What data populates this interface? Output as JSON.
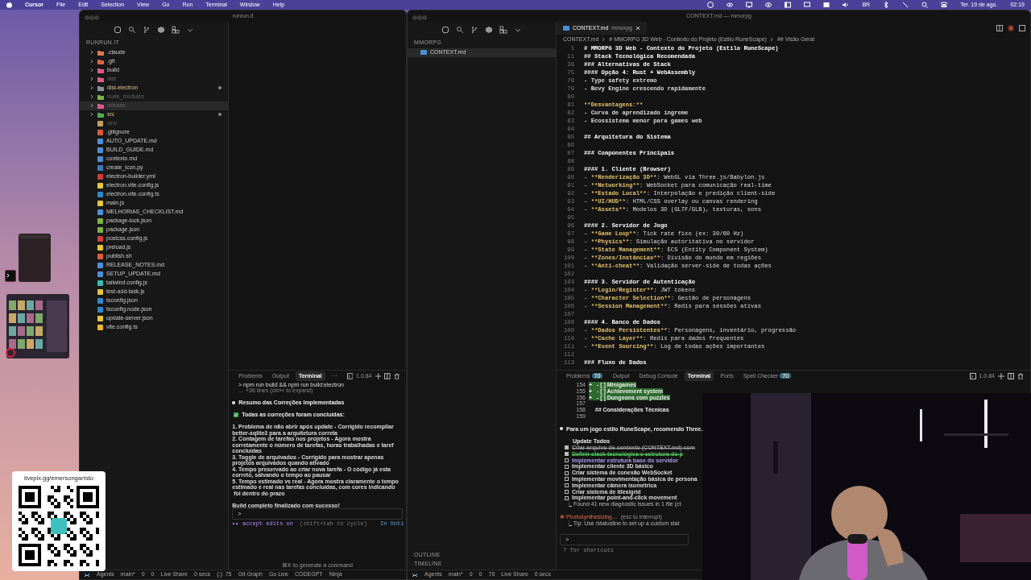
{
  "menubar": {
    "app": "Cursor",
    "menus": [
      "File",
      "Edit",
      "Selection",
      "View",
      "Go",
      "Run",
      "Terminal",
      "Window",
      "Help"
    ],
    "input_source": "BR",
    "date": "Ter. 19 de ago.",
    "time": "02:19"
  },
  "left_window": {
    "title": "runrun.it",
    "explorer_title": "RUNRUN.IT",
    "tree": [
      {
        "name": ".claude",
        "kind": "folder",
        "color": "#e8744f",
        "dimmed": false,
        "modified": false,
        "selected": false
      },
      {
        "name": ".git",
        "kind": "folder",
        "color": "#e0603f",
        "dimmed": false,
        "modified": false,
        "selected": false
      },
      {
        "name": "build",
        "kind": "folder",
        "color": "#e25a8c",
        "dimmed": false,
        "modified": false,
        "selected": false
      },
      {
        "name": "dist",
        "kind": "folder",
        "color": "#e25a8c",
        "dimmed": true,
        "modified": false,
        "selected": false
      },
      {
        "name": "dist-electron",
        "kind": "folder",
        "color": "#8a9199",
        "dimmed": false,
        "modified": true,
        "selected": false
      },
      {
        "name": "node_modules",
        "kind": "folder",
        "color": "#7cb342",
        "dimmed": true,
        "modified": false,
        "selected": false
      },
      {
        "name": "release",
        "kind": "folder",
        "color": "#e25a8c",
        "dimmed": true,
        "modified": false,
        "selected": true
      },
      {
        "name": "src",
        "kind": "folder",
        "color": "#4caf50",
        "dimmed": false,
        "modified": true,
        "selected": false
      },
      {
        "name": ".env",
        "kind": "file",
        "color": "#c0a060",
        "dimmed": true,
        "modified": false,
        "selected": false
      },
      {
        "name": ".gitignore",
        "kind": "file",
        "color": "#e05a3a",
        "dimmed": false,
        "modified": false,
        "selected": false
      },
      {
        "name": "AUTO_UPDATE.md",
        "kind": "file",
        "color": "#4a90d9",
        "dimmed": false,
        "modified": false,
        "selected": false
      },
      {
        "name": "BUILD_GUIDE.md",
        "kind": "file",
        "color": "#4a90d9",
        "dimmed": false,
        "modified": false,
        "selected": false
      },
      {
        "name": "contexto.md",
        "kind": "file",
        "color": "#4a90d9",
        "dimmed": false,
        "modified": false,
        "selected": false
      },
      {
        "name": "create_icon.py",
        "kind": "file",
        "color": "#3b7bbf",
        "dimmed": false,
        "modified": false,
        "selected": false
      },
      {
        "name": "electron-builder.yml",
        "kind": "file",
        "color": "#d9353a",
        "dimmed": false,
        "modified": false,
        "selected": false
      },
      {
        "name": "electron.vite.config.js",
        "kind": "file",
        "color": "#e8c53a",
        "dimmed": false,
        "modified": false,
        "selected": false
      },
      {
        "name": "electron.vite.config.ts",
        "kind": "file",
        "color": "#2f87cf",
        "dimmed": false,
        "modified": false,
        "selected": false
      },
      {
        "name": "main.js",
        "kind": "file",
        "color": "#e8c53a",
        "dimmed": false,
        "modified": false,
        "selected": false
      },
      {
        "name": "MELHORIAS_CHECKLIST.md",
        "kind": "file",
        "color": "#4a90d9",
        "dimmed": false,
        "modified": false,
        "selected": false
      },
      {
        "name": "package-lock.json",
        "kind": "file",
        "color": "#7cb342",
        "dimmed": false,
        "modified": false,
        "selected": false
      },
      {
        "name": "package.json",
        "kind": "file",
        "color": "#7cb342",
        "dimmed": false,
        "modified": false,
        "selected": false
      },
      {
        "name": "postcss.config.js",
        "kind": "file",
        "color": "#dd3a3a",
        "dimmed": false,
        "modified": false,
        "selected": false
      },
      {
        "name": "preload.js",
        "kind": "file",
        "color": "#e8c53a",
        "dimmed": false,
        "modified": false,
        "selected": false
      },
      {
        "name": "publish.sh",
        "kind": "file",
        "color": "#e05a3a",
        "dimmed": false,
        "modified": false,
        "selected": false
      },
      {
        "name": "RELEASE_NOTES.md",
        "kind": "file",
        "color": "#4a90d9",
        "dimmed": false,
        "modified": false,
        "selected": false
      },
      {
        "name": "SETUP_UPDATE.md",
        "kind": "file",
        "color": "#4a90d9",
        "dimmed": false,
        "modified": false,
        "selected": false
      },
      {
        "name": "tailwind.config.js",
        "kind": "file",
        "color": "#38bdb0",
        "dimmed": false,
        "modified": false,
        "selected": false
      },
      {
        "name": "test-add-task.js",
        "kind": "file",
        "color": "#e8c53a",
        "dimmed": false,
        "modified": false,
        "selected": false
      },
      {
        "name": "tsconfig.json",
        "kind": "file",
        "color": "#2f87cf",
        "dimmed": false,
        "modified": false,
        "selected": false
      },
      {
        "name": "tsconfig.node.json",
        "kind": "file",
        "color": "#2f87cf",
        "dimmed": false,
        "modified": false,
        "selected": false
      },
      {
        "name": "update-server.json",
        "kind": "file",
        "color": "#e8c53a",
        "dimmed": false,
        "modified": false,
        "selected": false
      },
      {
        "name": "vite.config.ts",
        "kind": "file",
        "color": "#f0b429",
        "dimmed": false,
        "modified": false,
        "selected": false
      }
    ],
    "panel": {
      "tabs": [
        {
          "label": "Problems",
          "selected": false
        },
        {
          "label": "Output",
          "selected": false
        },
        {
          "label": "Terminal",
          "selected": true
        },
        {
          "label": "···",
          "selected": false
        }
      ],
      "version": "1.0.84",
      "lines": [
        {
          "kind": "command",
          "text": "> npm run build && npm run build:electron"
        },
        {
          "kind": "dim",
          "text": "… +36 lines (ctrl+r to expand)"
        },
        {
          "kind": "blank"
        },
        {
          "kind": "bullet",
          "text": "Resumo das Correções Implementadas"
        },
        {
          "kind": "blank"
        },
        {
          "kind": "check",
          "text": "Todas as correções foram concluídas:"
        },
        {
          "kind": "blank"
        },
        {
          "kind": "plain",
          "text": "1. Problema de não abrir após update - Corrigido recompilar"
        },
        {
          "kind": "plain",
          "text": "better-sqlite3 para a arquitetura correta"
        },
        {
          "kind": "plain",
          "text": "2. Contagem de tarefas nos projetos - Agora mostra"
        },
        {
          "kind": "plain",
          "text": "corretamente o número de tarefas, horas trabalhadas e taref"
        },
        {
          "kind": "plain",
          "text": "concluídas"
        },
        {
          "kind": "plain",
          "text": "3. Toggle de arquivados - Corrigido para mostrar apenas"
        },
        {
          "kind": "plain",
          "text": "projetos arquivados quando ativado"
        },
        {
          "kind": "plain",
          "text": "4. Tempo preservado ao criar nova tarefa - O código já esta"
        },
        {
          "kind": "plain",
          "text": "correto, salvando o tempo ao pausar"
        },
        {
          "kind": "plain",
          "text": "5. Tempo estimado vs real - Agora mostra claramente o tempo"
        },
        {
          "kind": "plain",
          "text": "estimado e real nas tarefas concluídas, com cores indicando"
        },
        {
          "kind": "plain",
          "text": " foi dentro do prazo"
        },
        {
          "kind": "blank"
        },
        {
          "kind": "plain",
          "text": "Build completo finalizado com sucesso!"
        }
      ],
      "prompt": ">",
      "mode": "▸▸ accept edits on",
      "mode_hint": "(shift+tab to cycle)",
      "mode_right": "In Unti",
      "footer_hint": "⌘K to generate a command"
    },
    "status_bar": [
      "Agents",
      "main*",
      "0",
      "0",
      "Live Share",
      "0 secs",
      "{.}: 75",
      "Git Graph",
      "Go Live",
      "CODEGPT",
      "Ninja"
    ]
  },
  "right_window": {
    "title": "CONTEXT.md — mmorpg",
    "explorer_title": "MMORPG",
    "files": [
      {
        "name": "CONTEXT.md",
        "selected": true
      }
    ],
    "sections": [
      "OUTLINE",
      "TIMELINE"
    ],
    "tab": {
      "label": "CONTEXT.md",
      "folder": "mmorpg"
    },
    "breadcrumb": [
      "CONTEXT.md",
      "# MMORPG 3D Web - Contexto do Projeto (Estilo RuneScape)",
      "## Visão Geral"
    ],
    "sticky_lines": [
      {
        "num": "1",
        "text": "# MMORPG 3D Web - Contexto do Projeto (Estilo RuneScape)"
      },
      {
        "num": "11",
        "text": "## Stack Tecnológica Recomendada"
      },
      {
        "num": "38",
        "text": "### Alternativas de Stack"
      },
      {
        "num": "75",
        "text": "#### Opção 4: Rust + WebAssembly"
      }
    ],
    "lines": [
      {
        "num": "78",
        "kind": "text",
        "text": "- Type safety extremo"
      },
      {
        "num": "79",
        "kind": "text",
        "text": "- Bevy Engine crescendo rapidamente"
      },
      {
        "num": "80",
        "kind": "blank"
      },
      {
        "num": "81",
        "kind": "strong",
        "text": "**Desvantagens:**"
      },
      {
        "num": "82",
        "kind": "text",
        "text": "- Curva de aprendizado íngreme"
      },
      {
        "num": "83",
        "kind": "text",
        "text": "- Ecossistema menor para games web"
      },
      {
        "num": "84",
        "kind": "blank"
      },
      {
        "num": "85",
        "kind": "heading",
        "text": "## Arquitetura do Sistema"
      },
      {
        "num": "86",
        "kind": "blank"
      },
      {
        "num": "87",
        "kind": "heading",
        "text": "### Componentes Principais"
      },
      {
        "num": "88",
        "kind": "blank"
      },
      {
        "num": "89",
        "kind": "heading",
        "text": "#### 1. Cliente (Browser)"
      },
      {
        "num": "90",
        "kind": "item",
        "prefix": "- ",
        "strong": "**Renderização 3D**",
        "text": ": WebGL via Three.js/Babylon.js"
      },
      {
        "num": "91",
        "kind": "item",
        "prefix": "- ",
        "strong": "**Networking**",
        "text": ": WebSocket para comunicação real-time"
      },
      {
        "num": "92",
        "kind": "item",
        "prefix": "- ",
        "strong": "**Estado Local**",
        "text": ": Interpolação e predição client-side"
      },
      {
        "num": "93",
        "kind": "item",
        "prefix": "- ",
        "strong": "**UI/HUD**",
        "text": ": HTML/CSS overlay ou canvas rendering"
      },
      {
        "num": "94",
        "kind": "item",
        "prefix": "- ",
        "strong": "**Assets**",
        "text": ": Modelos 3D (GLTF/GLB), texturas, sons"
      },
      {
        "num": "95",
        "kind": "blank"
      },
      {
        "num": "96",
        "kind": "heading",
        "text": "#### 2. Servidor de Jogo"
      },
      {
        "num": "97",
        "kind": "item",
        "prefix": "- ",
        "strong": "**Game Loop**",
        "text": ": Tick rate fixo (ex: 30/60 Hz)"
      },
      {
        "num": "98",
        "kind": "item",
        "prefix": "- ",
        "strong": "**Physics**",
        "text": ": Simulação autoritativa no servidor"
      },
      {
        "num": "99",
        "kind": "item",
        "prefix": "- ",
        "strong": "**State Management**",
        "text": ": ECS (Entity Component System)"
      },
      {
        "num": "100",
        "kind": "item",
        "prefix": "- ",
        "strong": "**Zones/Instâncias**",
        "text": ": Divisão do mundo em regiões"
      },
      {
        "num": "101",
        "kind": "item",
        "prefix": "- ",
        "strong": "**Anti-cheat**",
        "text": ": Validação server-side de todas ações"
      },
      {
        "num": "102",
        "kind": "blank"
      },
      {
        "num": "103",
        "kind": "heading",
        "text": "#### 3. Servidor de Autenticação"
      },
      {
        "num": "104",
        "kind": "item",
        "prefix": "- ",
        "strong": "**Login/Register**",
        "text": ": JWT tokens"
      },
      {
        "num": "105",
        "kind": "item",
        "prefix": "- ",
        "strong": "**Character Selection**",
        "text": ": Gestão de personagens"
      },
      {
        "num": "106",
        "kind": "item",
        "prefix": "- ",
        "strong": "**Session Management**",
        "text": ": Redis para sessões ativas"
      },
      {
        "num": "107",
        "kind": "blank"
      },
      {
        "num": "108",
        "kind": "heading",
        "text": "#### 4. Banco de Dados"
      },
      {
        "num": "109",
        "kind": "item",
        "prefix": "- ",
        "strong": "**Dados Persistentes**",
        "text": ": Personagens, inventário, progressão"
      },
      {
        "num": "110",
        "kind": "item",
        "prefix": "- ",
        "strong": "**Cache Layer**",
        "text": ": Redis para dados frequentes"
      },
      {
        "num": "111",
        "kind": "item",
        "prefix": "- ",
        "strong": "**Event Sourcing**",
        "text": ": Log de todas ações importantes"
      },
      {
        "num": "112",
        "kind": "blank"
      },
      {
        "num": "113",
        "kind": "heading",
        "text": "### Fluxo de Dados"
      }
    ],
    "panel": {
      "tabs": [
        {
          "label": "Problems",
          "badge": "70",
          "selected": false
        },
        {
          "label": "Output",
          "selected": false
        },
        {
          "label": "Debug Console",
          "selected": false
        },
        {
          "label": "Terminal",
          "selected": true
        },
        {
          "label": "Ports",
          "selected": false
        },
        {
          "label": "Spell Checker",
          "badge": "70",
          "selected": false
        }
      ],
      "version": "1.0.84",
      "lines": [
        {
          "kind": "diff_added",
          "num": "154",
          "text": "+   - [ ] Minigames"
        },
        {
          "kind": "diff_added",
          "num": "155",
          "text": "+   - [ ] Achievement system"
        },
        {
          "kind": "diff_added",
          "num": "156",
          "text": "+   - [ ] Dungeons com puzzles"
        },
        {
          "kind": "diff",
          "num": "157"
        },
        {
          "kind": "diff",
          "num": "158",
          "text": "    ## Considerações Técnicas"
        },
        {
          "kind": "diff",
          "num": "159"
        },
        {
          "kind": "blank"
        },
        {
          "kind": "bullet",
          "text": "Para um jogo estilo RuneScape, recomendo Three."
        },
        {
          "kind": "blank"
        },
        {
          "kind": "heading",
          "text": "Update Todos"
        },
        {
          "kind": "todo",
          "checked": true,
          "highlighted": false,
          "text": "Criar arquivo de contexto (CONTEXT.md) com"
        },
        {
          "kind": "todo",
          "checked": true,
          "highlighted": true,
          "text": "Definir stack tecnológica e estrutura do p"
        },
        {
          "kind": "todo",
          "checked": false,
          "highlighted": true,
          "text": "Implementar estrutura base do servidor"
        },
        {
          "kind": "todo",
          "checked": false,
          "highlighted": false,
          "text": "Implementar cliente 3D básico"
        },
        {
          "kind": "todo",
          "checked": false,
          "highlighted": false,
          "text": "Criar sistema de conexão WebSocket"
        },
        {
          "kind": "todo",
          "checked": false,
          "highlighted": false,
          "text": "Implementar movimentação básica de persona"
        },
        {
          "kind": "todo",
          "checked": false,
          "highlighted": false,
          "text": "Implementar câmera isométrica"
        },
        {
          "kind": "todo",
          "checked": false,
          "highlighted": false,
          "text": "Criar sistema de tiles/grid"
        },
        {
          "kind": "todo",
          "checked": false,
          "highlighted": false,
          "text": "Implementar point-and-click movement"
        },
        {
          "kind": "result",
          "text": "⎿ Found 41 new diagnostic issues in 1 file (ct"
        },
        {
          "kind": "blank"
        },
        {
          "kind": "working",
          "label": "✻ Photosynthesizing…",
          "text": "(esc to interrupt)"
        },
        {
          "kind": "result",
          "text": "⎿ Tip: Use /statusline to set up a custom stat"
        }
      ],
      "prompt": ">",
      "footer": "? for shortcuts"
    },
    "status_bar": [
      "Agents",
      "main*",
      "0",
      "0",
      "70",
      "Live Share",
      "0 secs"
    ]
  },
  "donation": {
    "url": "livepix.gg/emersongarrido"
  }
}
